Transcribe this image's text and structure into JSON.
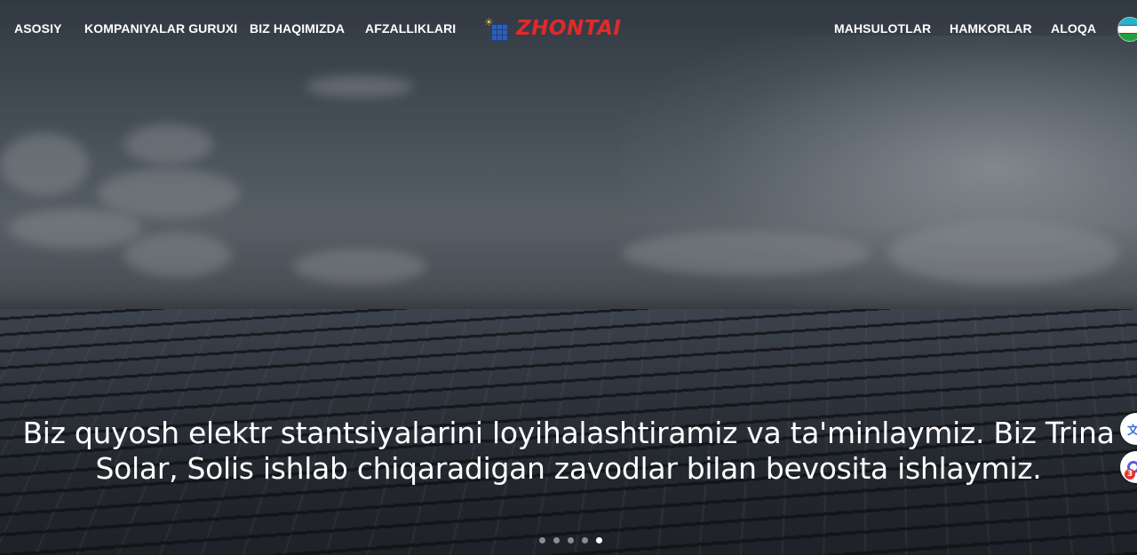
{
  "nav": {
    "left": [
      "ASOSIY",
      "KOMPANIYALAR GURUXI",
      "BIZ HAQIMIZDA",
      "AFZALLIKLARI"
    ],
    "right": [
      "MAHSULOTLAR",
      "HAMKORLAR",
      "ALOQA"
    ],
    "logo_text": "ZHONTAI",
    "language_flag": "uzbekistan-flag-icon"
  },
  "hero": {
    "caption_line1": "Biz quyosh elektr stantsiyalarini loyihalashtiramiz va ta'minlaymiz. Biz Trina",
    "caption_line2": "Solar, Solis ishlab chiqaradigan zavodlar bilan bevosita ishlaymiz."
  },
  "carousel": {
    "slides": 5,
    "active_index": 4
  },
  "widgets": {
    "translate_icon": "translate-icon",
    "support_icon": "support-chat-icon",
    "support_badge": "3"
  },
  "colors": {
    "logo_red": "#e02a2a",
    "logo_blue": "#2f5fb3",
    "text": "#ffffff"
  }
}
